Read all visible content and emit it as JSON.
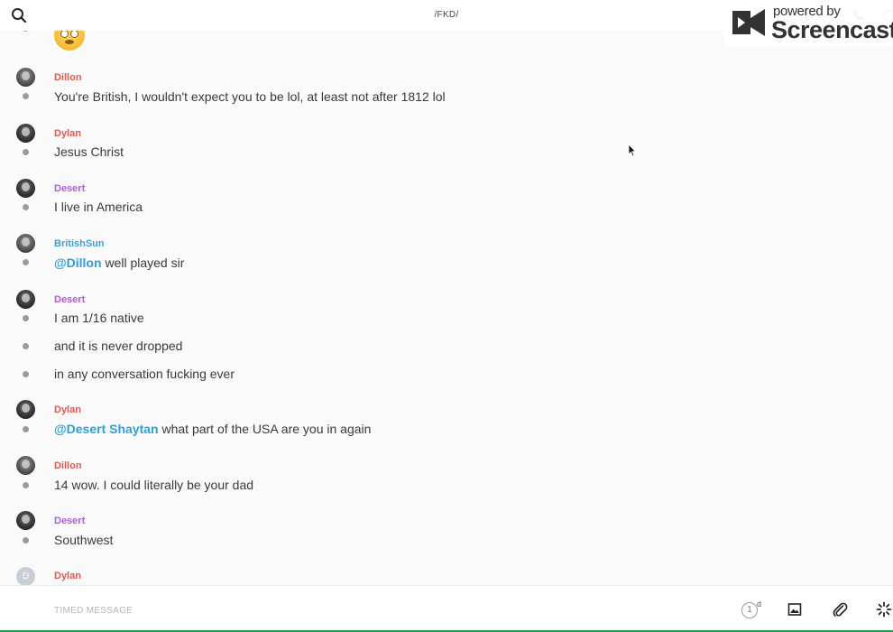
{
  "header": {
    "channel_title": "/FKD/"
  },
  "watermark": {
    "powered_by": "powered by",
    "brand": "Screencastify"
  },
  "messages": [
    {
      "author": "Dillon",
      "lines": [
        "You're British, I wouldn't expect you to be lol, at least not after 1812 lol"
      ]
    },
    {
      "author": "Dylan",
      "lines": [
        "Jesus Christ"
      ]
    },
    {
      "author": "Desert",
      "lines": [
        "I live in America"
      ]
    },
    {
      "author": "BritishSun",
      "mention": "@Dillon",
      "lines": [
        "well played sir"
      ]
    },
    {
      "author": "Desert",
      "lines": [
        "I am 1/16 native",
        "and it is never dropped",
        "in any conversation fucking ever"
      ]
    },
    {
      "author": "Dylan",
      "mention": "@Desert Shaytan",
      "lines": [
        "what part of the USA are you in again"
      ]
    },
    {
      "author": "Dillon",
      "lines": [
        "14 wow. I could literally be your dad"
      ]
    },
    {
      "author": "Desert",
      "lines": [
        "Southwest"
      ]
    },
    {
      "author": "Dylan",
      "avatar_letter": "D",
      "lines": []
    }
  ],
  "composer": {
    "placeholder": "TIMED MESSAGE",
    "timer_value": "1",
    "timer_unit": "d"
  },
  "colors": {
    "author_red": "#e0584f",
    "author_purple": "#b35ad6",
    "author_blue": "#3aa0d8",
    "mention": "#2f9fd9"
  }
}
